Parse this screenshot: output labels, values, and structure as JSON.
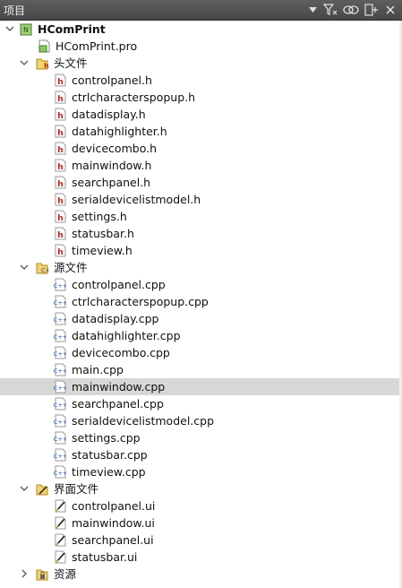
{
  "panel": {
    "title": "项目",
    "toolbar": [
      {
        "name": "dropdown-arrow-icon"
      },
      {
        "name": "filter-icon"
      },
      {
        "name": "sync-link-icon"
      },
      {
        "name": "split-view-icon"
      },
      {
        "name": "close-icon"
      }
    ]
  },
  "project": {
    "name": "HComPrint",
    "pro_file": "HComPrint.pro"
  },
  "groups": {
    "headers": {
      "label": "头文件",
      "files": [
        "controlpanel.h",
        "ctrlcharacterspopup.h",
        "datadisplay.h",
        "datahighlighter.h",
        "devicecombo.h",
        "mainwindow.h",
        "searchpanel.h",
        "serialdevicelistmodel.h",
        "settings.h",
        "statusbar.h",
        "timeview.h"
      ]
    },
    "sources": {
      "label": "源文件",
      "files": [
        "controlpanel.cpp",
        "ctrlcharacterspopup.cpp",
        "datadisplay.cpp",
        "datahighlighter.cpp",
        "devicecombo.cpp",
        "main.cpp",
        "mainwindow.cpp",
        "searchpanel.cpp",
        "serialdevicelistmodel.cpp",
        "settings.cpp",
        "statusbar.cpp",
        "timeview.cpp"
      ]
    },
    "forms": {
      "label": "界面文件",
      "files": [
        "controlpanel.ui",
        "mainwindow.ui",
        "searchpanel.ui",
        "statusbar.ui"
      ]
    },
    "resources": {
      "label": "资源"
    }
  },
  "selected_file": "mainwindow.cpp"
}
